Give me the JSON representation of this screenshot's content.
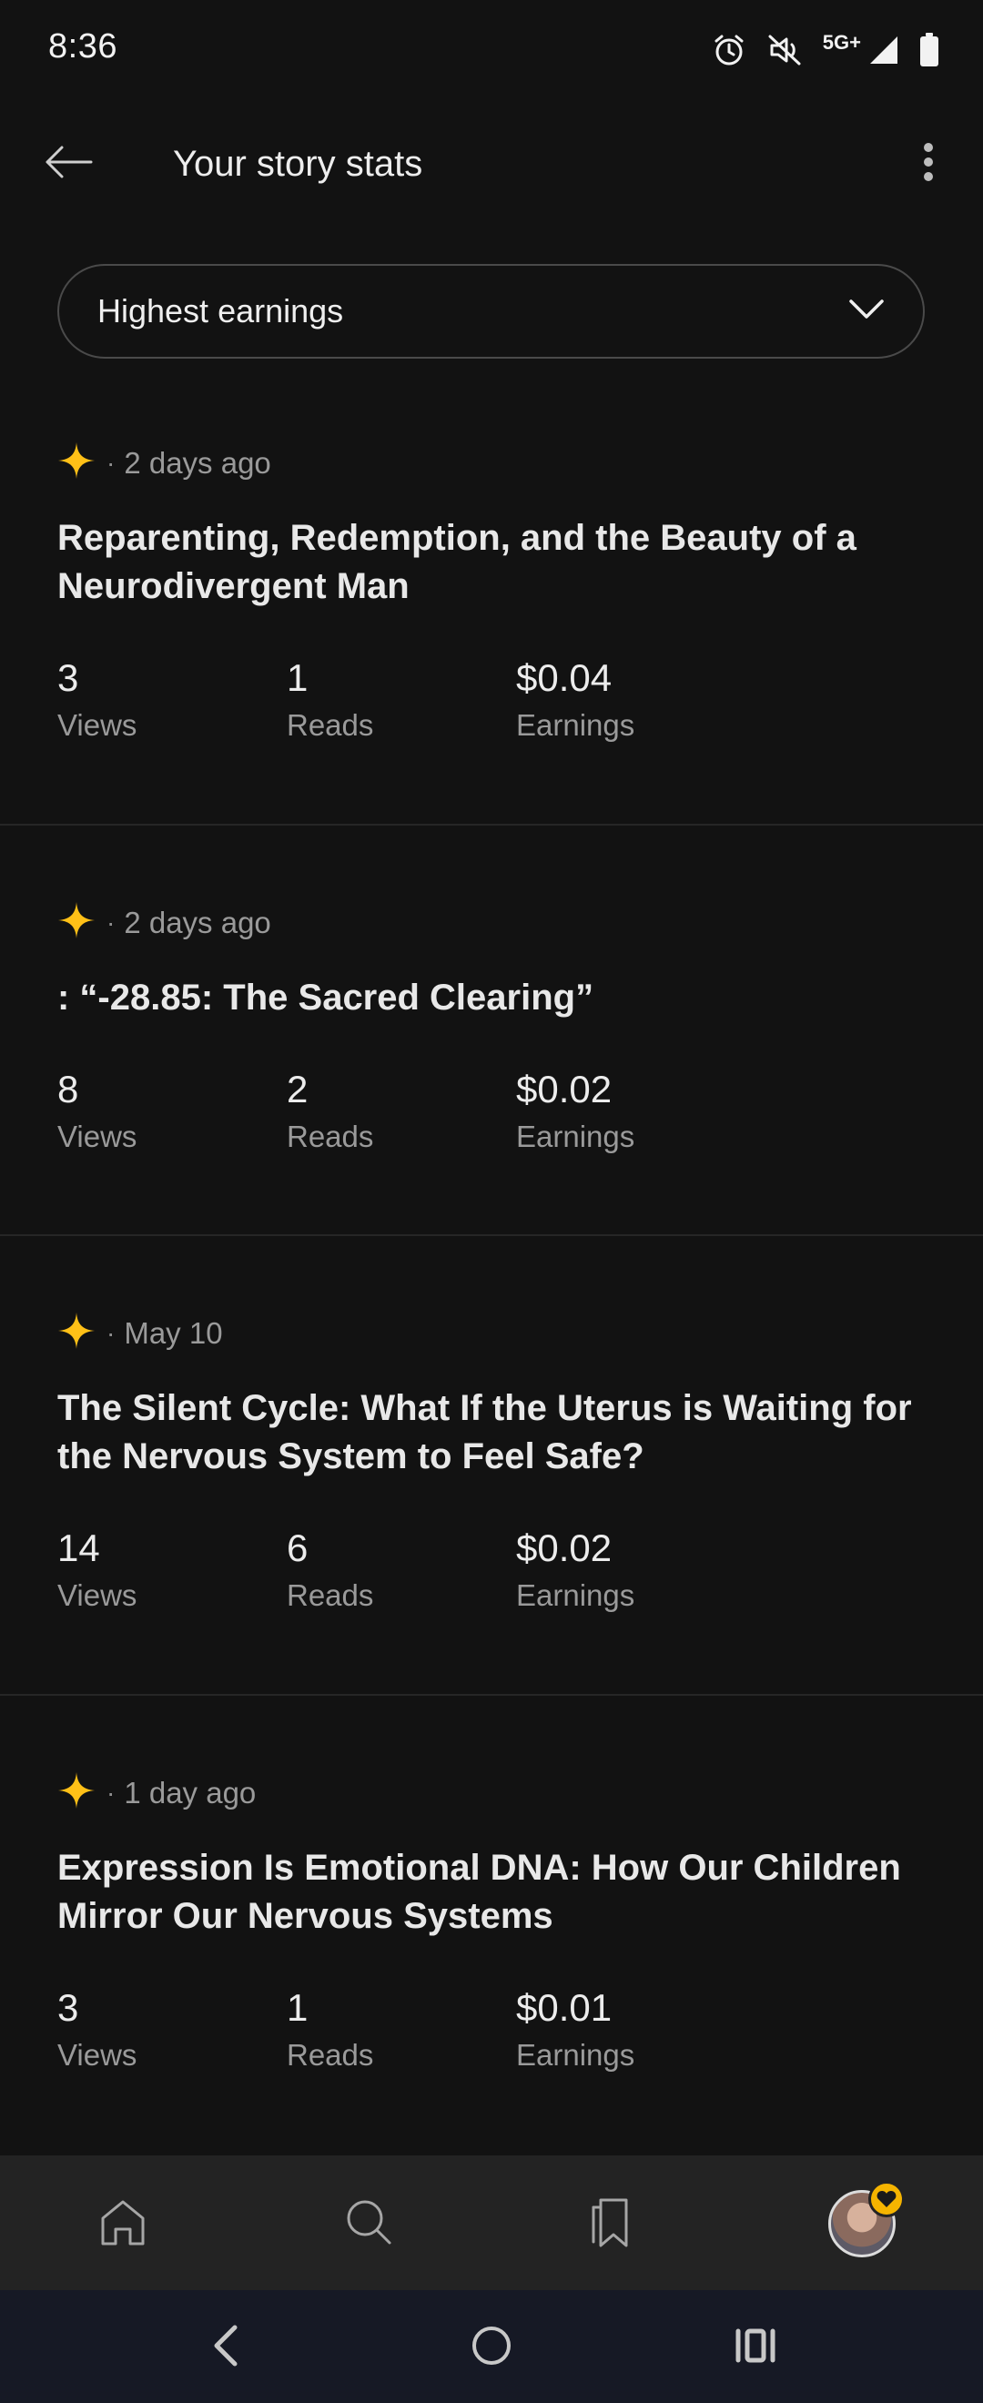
{
  "status_bar": {
    "time": "8:36",
    "network": "5G+",
    "icons": [
      "alarm-icon",
      "mute-icon",
      "signal-icon",
      "battery-icon"
    ]
  },
  "header": {
    "title": "Your story stats",
    "back_icon": "arrow-left-icon",
    "menu_icon": "more-vertical-icon"
  },
  "sort": {
    "selected": "Highest earnings",
    "icon": "chevron-down-icon"
  },
  "colors": {
    "background": "#121212",
    "star": "#FFC017",
    "divider": "#262626",
    "nav_bar": "#232323",
    "system_bar": "#161925"
  },
  "stories": [
    {
      "date": "2 days ago",
      "title": "Reparenting, Redemption, and the Beauty of a Neurodivergent Man",
      "views": "3",
      "views_label": "Views",
      "reads": "1",
      "reads_label": "Reads",
      "earnings": "$0.04",
      "earnings_label": "Earnings"
    },
    {
      "date": "2 days ago",
      "title": ": “-28.85: The Sacred Clearing”",
      "views": "8",
      "views_label": "Views",
      "reads": "2",
      "reads_label": "Reads",
      "earnings": "$0.02",
      "earnings_label": "Earnings"
    },
    {
      "date": "May 10",
      "title": "The Silent Cycle: What If the Uterus is Waiting for the Nervous System to Feel Safe?",
      "views": "14",
      "views_label": "Views",
      "reads": "6",
      "reads_label": "Reads",
      "earnings": "$0.02",
      "earnings_label": "Earnings"
    },
    {
      "date": "1 day ago",
      "title": "Expression Is Emotional DNA: How Our Children Mirror Our Nervous Systems",
      "views": "3",
      "views_label": "Views",
      "reads": "1",
      "reads_label": "Reads",
      "earnings": "$0.01",
      "earnings_label": "Earnings"
    }
  ],
  "bottom_nav": {
    "items": [
      "home-icon",
      "search-icon",
      "bookmarks-icon",
      "profile-avatar"
    ]
  },
  "system_nav": {
    "items": [
      "back-icon",
      "home-circle-icon",
      "recents-icon"
    ]
  }
}
